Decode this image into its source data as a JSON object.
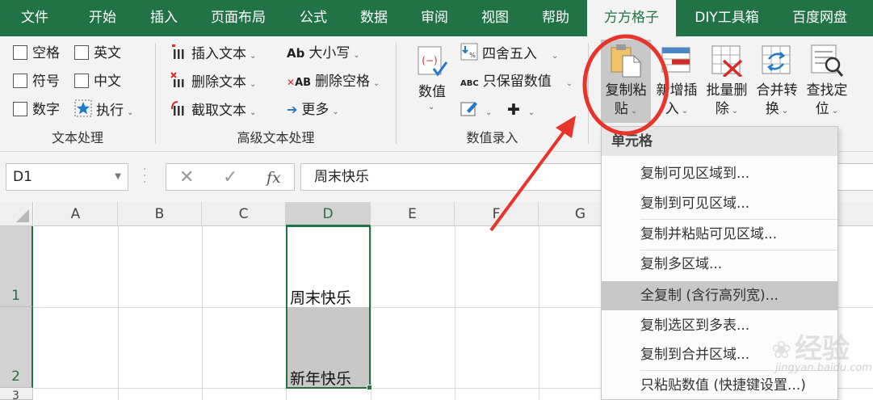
{
  "menu_tabs": [
    "文件",
    "开始",
    "插入",
    "页面布局",
    "公式",
    "数据",
    "审阅",
    "视图",
    "帮助",
    "方方格子",
    "DIY工具箱",
    "百度网盘"
  ],
  "active_tab": "方方格子",
  "ribbon": {
    "text_processing": {
      "label": "文本处理",
      "checkboxes": [
        "空格",
        "英文",
        "符号",
        "中文",
        "数字"
      ],
      "execute_label": "执行"
    },
    "advanced_text": {
      "label": "高级文本处理",
      "insert_text": "插入文本",
      "delete_text": "删除文本",
      "extract_text": "截取文本",
      "case": "大小写",
      "case_icon_text": "Ab",
      "delete_spaces": "删除空格",
      "delete_spaces_icon_text": "AB",
      "more": "更多"
    },
    "numeric_entry": {
      "label": "数值录入",
      "numeric": "数值",
      "round": "四舍五入",
      "keep_values": "只保留数值",
      "keep_values_icon_text": "ABC"
    },
    "cells": {
      "copy_paste": "复制粘贴",
      "insert_new": "新增插入",
      "batch_delete": "批量删除",
      "merge_convert": "合并转换",
      "find_locate": "查找定位"
    }
  },
  "formula_bar": {
    "name_box": "D1",
    "fx_label": "fx",
    "content": "周末快乐"
  },
  "grid": {
    "columns": [
      "A",
      "B",
      "C",
      "D",
      "E",
      "F",
      "G"
    ],
    "rows": [
      "1",
      "2",
      "3"
    ],
    "selected_column": "D",
    "cells": {
      "D1": "周末快乐",
      "D2": "新年快乐"
    }
  },
  "dropdown": {
    "header": "单元格",
    "items": [
      "复制可见区域到...",
      "复制到可见区域...",
      "复制并粘贴可见区域...",
      "复制多区域...",
      "全复制 (含行高列宽)...",
      "复制选区到多表...",
      "复制到合并区域...",
      "只粘贴数值 (快捷键设置...)"
    ],
    "highlighted_index": 4
  },
  "watermark": {
    "text": "经验",
    "url": "jingyan.baidu.com"
  },
  "colors": {
    "excel_green": "#217346",
    "annotation_red": "#e8342a"
  }
}
